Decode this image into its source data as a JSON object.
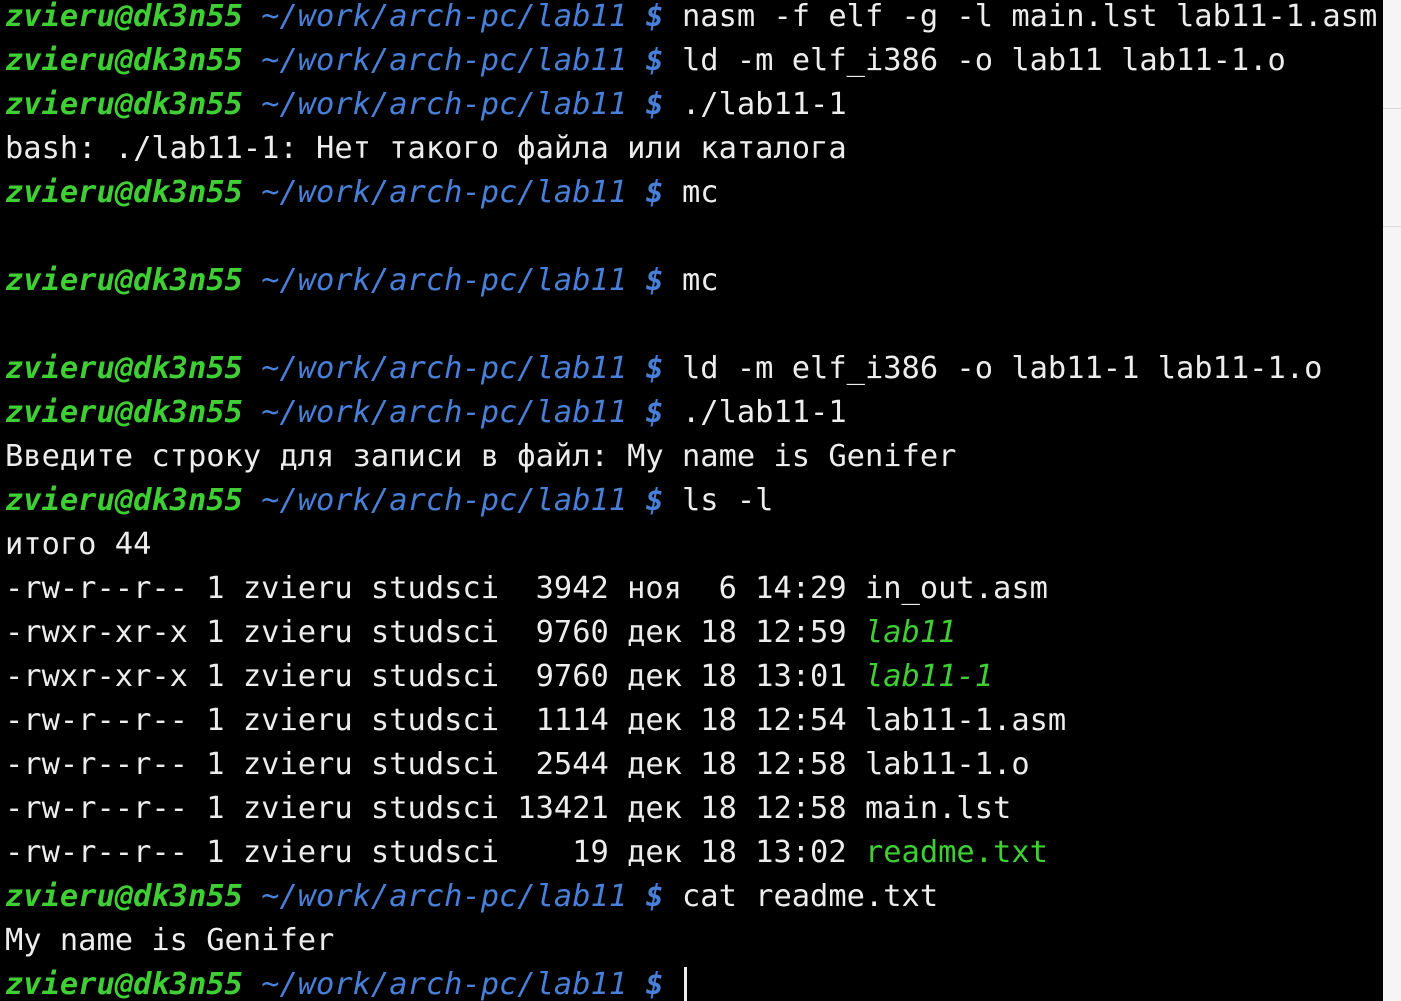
{
  "terminal": {
    "prompt": {
      "user_host": "zvieru@dk3n55",
      "path": "~/work/arch-pc/lab11",
      "symbol": "$"
    },
    "lines": [
      {
        "type": "prompt",
        "cmd": "nasm -f elf -g -l main.lst lab11-1.asm"
      },
      {
        "type": "prompt",
        "cmd": "ld -m elf_i386 -o lab11 lab11-1.o"
      },
      {
        "type": "prompt",
        "cmd": "./lab11-1"
      },
      {
        "type": "output",
        "text": "bash: ./lab11-1: Нет такого файла или каталога"
      },
      {
        "type": "prompt",
        "cmd": "mc"
      },
      {
        "type": "blank"
      },
      {
        "type": "prompt",
        "cmd": "mc"
      },
      {
        "type": "blank"
      },
      {
        "type": "prompt",
        "cmd": "ld -m elf_i386 -o lab11-1 lab11-1.o"
      },
      {
        "type": "prompt",
        "cmd": "./lab11-1"
      },
      {
        "type": "output",
        "text": "Введите строку для записи в файл: My name is Genifer"
      },
      {
        "type": "prompt",
        "cmd": "ls -l"
      },
      {
        "type": "output",
        "text": "итого 44"
      },
      {
        "type": "listing",
        "info": "-rw-r--r-- 1 zvieru studsci  3942 ноя  6 14:29 ",
        "name": "in_out.asm",
        "style": "plain"
      },
      {
        "type": "listing",
        "info": "-rwxr-xr-x 1 zvieru studsci  9760 дек 18 12:59 ",
        "name": "lab11",
        "style": "exec"
      },
      {
        "type": "listing",
        "info": "-rwxr-xr-x 1 zvieru studsci  9760 дек 18 13:01 ",
        "name": "lab11-1",
        "style": "exec"
      },
      {
        "type": "listing",
        "info": "-rw-r--r-- 1 zvieru studsci  1114 дек 18 12:54 ",
        "name": "lab11-1.asm",
        "style": "plain"
      },
      {
        "type": "listing",
        "info": "-rw-r--r-- 1 zvieru studsci  2544 дек 18 12:58 ",
        "name": "lab11-1.o",
        "style": "plain"
      },
      {
        "type": "listing",
        "info": "-rw-r--r-- 1 zvieru studsci 13421 дек 18 12:58 ",
        "name": "main.lst",
        "style": "plain"
      },
      {
        "type": "listing",
        "info": "-rw-r--r-- 1 zvieru studsci    19 дек 18 13:02 ",
        "name": "readme.txt",
        "style": "green"
      },
      {
        "type": "prompt",
        "cmd": "cat readme.txt"
      },
      {
        "type": "output",
        "text": "My name is Genifer"
      },
      {
        "type": "prompt",
        "cmd": "",
        "cursor": true
      }
    ]
  },
  "colors": {
    "background": "#000000",
    "foreground": "#ededed",
    "user_host": "#3fcf35",
    "path": "#4a7fd8",
    "executable": "#3fcf35"
  }
}
